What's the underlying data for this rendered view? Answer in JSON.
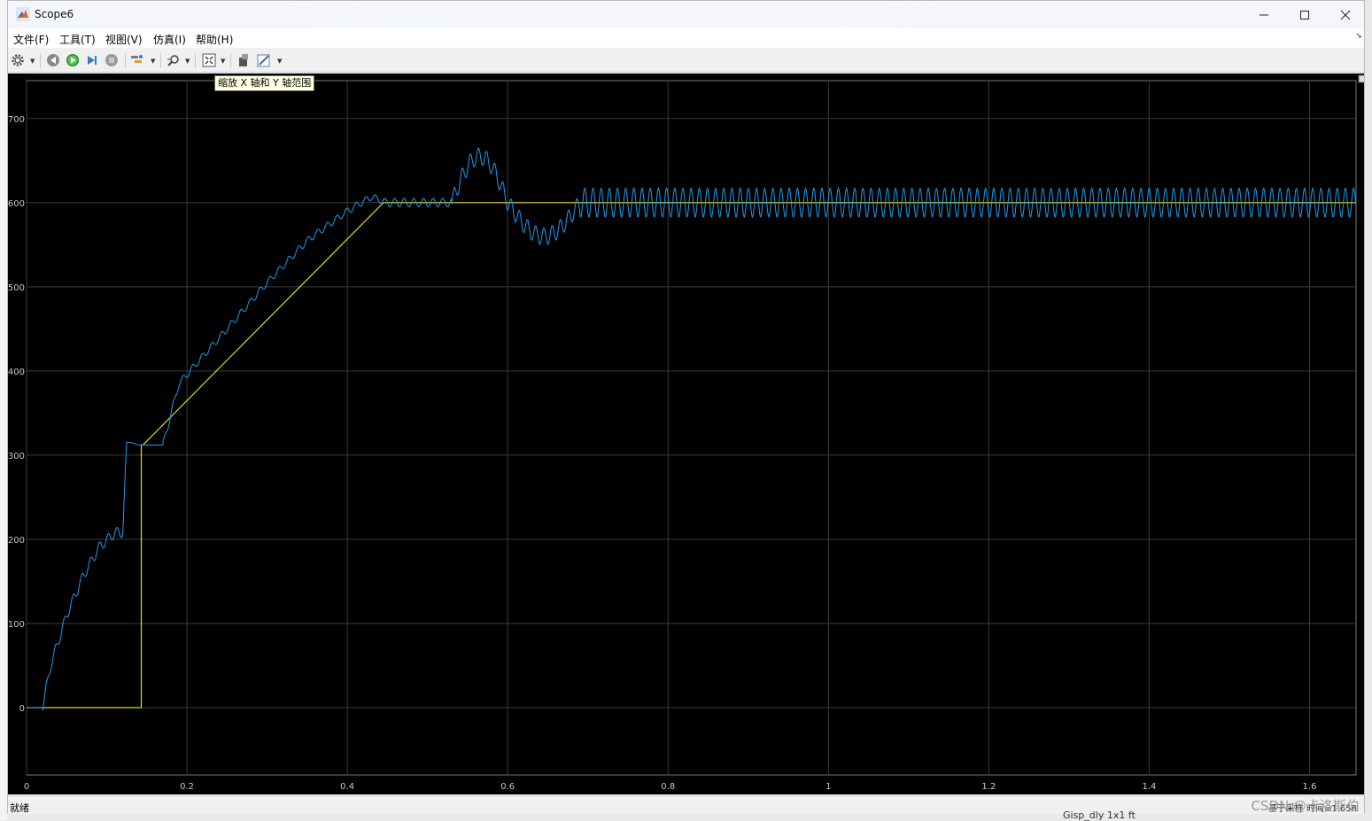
{
  "window": {
    "title": "Scope6"
  },
  "menu": {
    "items": [
      "文件(F)",
      "工具(T)",
      "视图(V)",
      "仿真(I)",
      "帮助(H)"
    ]
  },
  "toolbar": {
    "tooltip": "缩放 X 轴和 Y 轴范围",
    "buttons": [
      "settings-icon",
      "step-back-icon",
      "run-icon",
      "step-forward-icon",
      "stop-icon",
      "highlight-icon",
      "zoom-icon",
      "autoscale-icon",
      "restore-icon",
      "style-icon"
    ]
  },
  "status": {
    "left": "就绪",
    "right": "基于采样 时间=1.658"
  },
  "watermark": "CSDN @卡洛斯伯",
  "background_fragment": "Gisp_dly    1x1 ft",
  "colors": {
    "plot_bg": "#000000",
    "grid": "#3b3b3b",
    "series_blue": "#1f9cf0",
    "series_yellow": "#e3d72c",
    "tick_text": "#c9c9c9"
  },
  "chart_data": {
    "type": "line",
    "title": "",
    "xlabel": "",
    "ylabel": "",
    "xlim": [
      0,
      1.658
    ],
    "ylim": [
      -80,
      745
    ],
    "grid": true,
    "xticks": [
      0,
      0.2,
      0.4,
      0.6,
      0.8,
      1,
      1.2,
      1.4,
      1.6
    ],
    "xtick_labels": [
      "0",
      "0.2",
      "0.4",
      "0.6",
      "0.8",
      "1",
      "1.2",
      "1.4",
      "1.6"
    ],
    "yticks": [
      0,
      100,
      200,
      300,
      400,
      500,
      600,
      700
    ],
    "ytick_labels": [
      "0",
      "100",
      "200",
      "300",
      "400",
      "500",
      "600",
      "700"
    ],
    "series": [
      {
        "color": "#e3d72c",
        "x": [
          0,
          0.143,
          0.143,
          0.145,
          0.445,
          1.658
        ],
        "y": [
          0,
          0,
          312,
          312,
          600,
          600
        ]
      },
      {
        "color": "#1f9cf0",
        "x": [
          0,
          0.02,
          0.03,
          0.05,
          0.07,
          0.09,
          0.11,
          0.12,
          0.125,
          0.13,
          0.14,
          0.17,
          0.19,
          0.25,
          0.3,
          0.35,
          0.4,
          0.43,
          0.45,
          0.5,
          0.53,
          0.55,
          0.57,
          0.6,
          0.62,
          0.64,
          0.66,
          0.68,
          0.7,
          0.73,
          1.658
        ],
        "y": [
          0,
          0,
          50,
          110,
          155,
          190,
          208,
          208,
          315,
          315,
          312,
          312,
          385,
          450,
          505,
          555,
          590,
          607,
          600,
          598,
          600,
          630,
          655,
          590,
          560,
          555,
          585,
          605,
          615,
          618,
          618
        ]
      }
    ]
  }
}
